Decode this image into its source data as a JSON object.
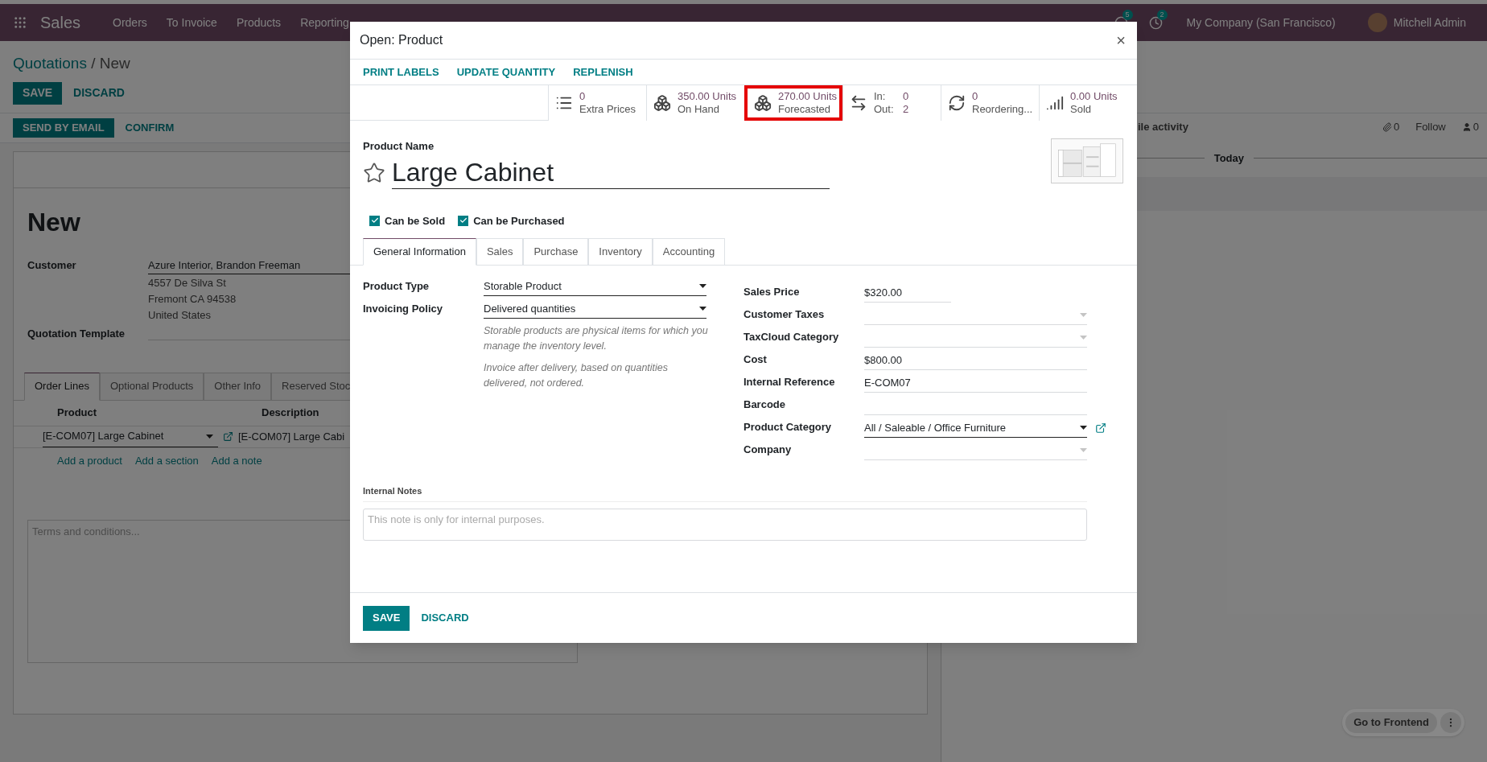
{
  "navbar": {
    "app": "Sales",
    "menu": [
      "Orders",
      "To Invoice",
      "Products",
      "Reporting"
    ],
    "chat_badge": "5",
    "activity_badge": "2",
    "company": "My Company (San Francisco)",
    "user": "Mitchell Admin"
  },
  "breadcrumb": {
    "parent": "Quotations",
    "current": "/ New"
  },
  "form_buttons": [
    {
      "label": "SAVE",
      "primary": true
    },
    {
      "label": "DISCARD",
      "primary": false
    }
  ],
  "status_buttons": [
    {
      "label": "SEND BY EMAIL",
      "primary": true
    },
    {
      "label": "CONFIRM",
      "primary": false
    }
  ],
  "quotation": {
    "title": "New",
    "customer_label": "Customer",
    "customer": "Azure Interior, Brandon Freeman",
    "address_lines": [
      "4557 De Silva St",
      "Fremont CA 94538",
      "United States"
    ],
    "template_label": "Quotation Template"
  },
  "tabs": [
    {
      "label": "Order Lines",
      "selected": true
    },
    {
      "label": "Optional Products",
      "selected": false
    },
    {
      "label": "Other Info",
      "selected": false
    },
    {
      "label": "Reserved Stoc",
      "selected": false
    }
  ],
  "order_lines": {
    "columns": [
      "Product",
      "Description"
    ],
    "rows": [
      {
        "product": "[E-COM07] Large Cabinet",
        "description": "[E-COM07] Large Cabi"
      }
    ],
    "add_links": [
      "Add a product",
      "Add a section",
      "Add a note"
    ]
  },
  "terms_placeholder": "Terms and conditions...",
  "chatter": {
    "activity_button": "ile activity",
    "attachments": "0",
    "follow": "Follow",
    "followers": "0",
    "date_separator": "Today"
  },
  "frontend_button": "Go to Frontend",
  "dialog": {
    "title": "Open: Product",
    "close": "×",
    "actions": [
      "PRINT LABELS",
      "UPDATE QUANTITY",
      "REPLENISH"
    ],
    "stats": [
      {
        "kind": "count",
        "value": "0",
        "label": "Extra Prices",
        "highlighted": false
      },
      {
        "kind": "count",
        "value": "350.00 Units",
        "label": "On Hand",
        "highlighted": false
      },
      {
        "kind": "count",
        "value": "270.00 Units",
        "label": "Forecasted",
        "highlighted": true
      },
      {
        "kind": "in_out",
        "in_label": "In:",
        "in_value": "0",
        "out_label": "Out:",
        "out_value": "2",
        "highlighted": false
      },
      {
        "kind": "count",
        "value": "0",
        "label": "Reordering...",
        "highlighted": false
      },
      {
        "kind": "count",
        "value": "0.00 Units",
        "label": "Sold",
        "highlighted": false
      }
    ],
    "product_label": "Product Name",
    "product_name": "Large Cabinet",
    "favorite": false,
    "checkboxes": [
      {
        "label": "Can be Sold",
        "checked": true
      },
      {
        "label": "Can be Purchased",
        "checked": true
      }
    ],
    "tabs": [
      {
        "label": "General Information",
        "selected": true
      },
      {
        "label": "Sales",
        "selected": false
      },
      {
        "label": "Purchase",
        "selected": false
      },
      {
        "label": "Inventory",
        "selected": false
      },
      {
        "label": "Accounting",
        "selected": false
      }
    ],
    "left_fields": [
      {
        "label": "Product Type",
        "kind": "select",
        "value": "Storable Product"
      },
      {
        "label": "Invoicing Policy",
        "kind": "select",
        "value": "Delivered quantities"
      }
    ],
    "help_texts": [
      "Storable products are physical items for which you manage the inventory level.",
      "Invoice after delivery, based on quantities delivered, not ordered."
    ],
    "right_fields": [
      {
        "label": "Sales Price",
        "kind": "price",
        "value": "$320.00"
      },
      {
        "label": "Customer Taxes",
        "kind": "select"
      },
      {
        "label": "TaxCloud Category",
        "kind": "select"
      },
      {
        "label": "Cost",
        "kind": "text",
        "value": "$800.00"
      },
      {
        "label": "Internal Reference",
        "kind": "text",
        "value": "E-COM07"
      },
      {
        "label": "Barcode",
        "kind": "text"
      },
      {
        "label": "Product Category",
        "kind": "link_select",
        "value": "All / Saleable / Office Furniture"
      },
      {
        "label": "Company",
        "kind": "select"
      }
    ],
    "notes": {
      "label": "Internal Notes",
      "placeholder": "This note is only for internal purposes."
    },
    "footer": [
      {
        "label": "SAVE",
        "primary": true
      },
      {
        "label": "DISCARD",
        "primary": false
      }
    ]
  }
}
